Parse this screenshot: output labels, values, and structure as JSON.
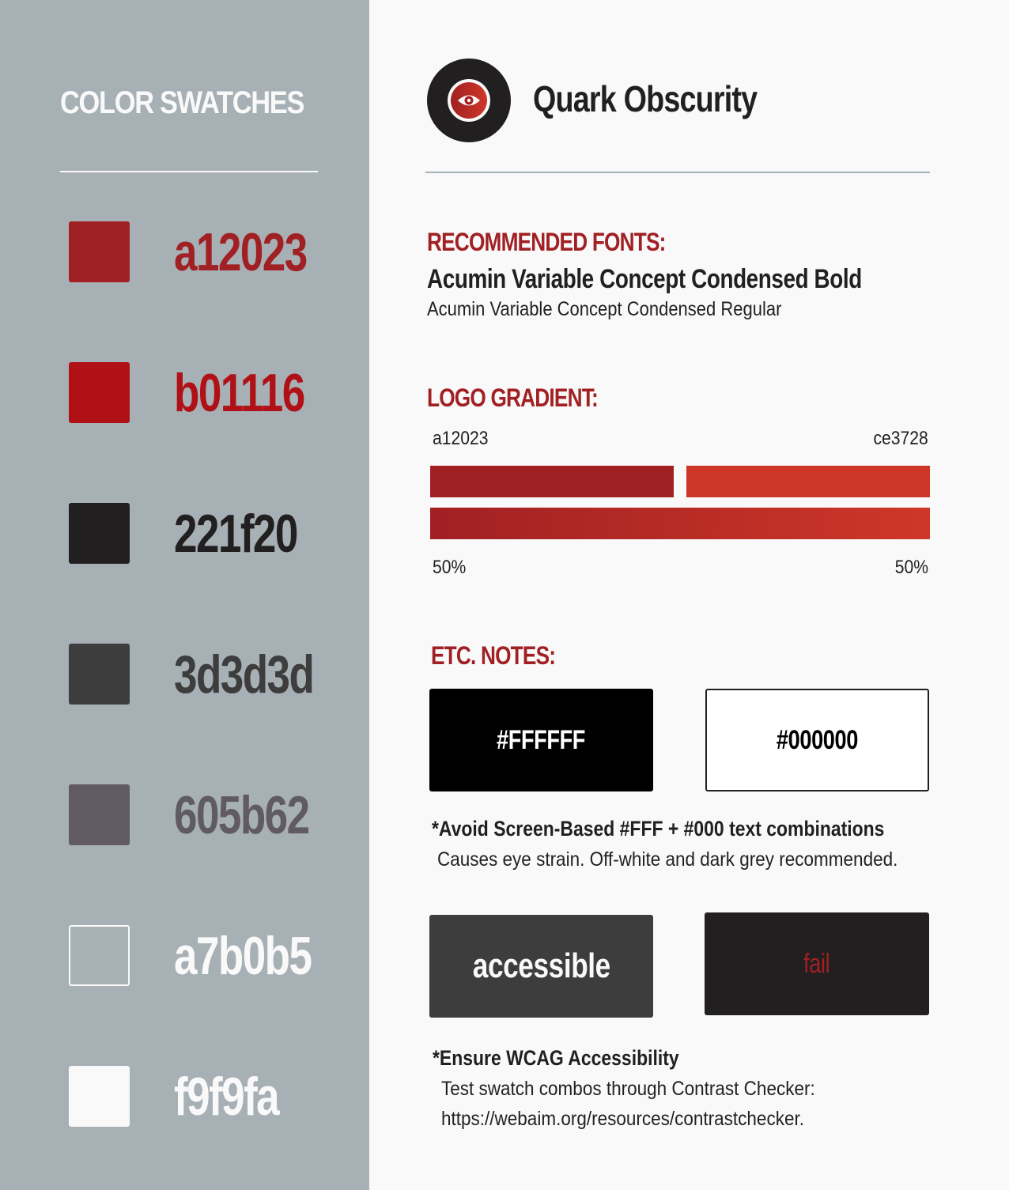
{
  "sidebar": {
    "title": "COLOR SWATCHES",
    "swatches": [
      {
        "code": "a12023",
        "color": "#a12023",
        "text_color": "#a12023"
      },
      {
        "code": "b01116",
        "color": "#b01116",
        "text_color": "#b01116"
      },
      {
        "code": "221f20",
        "color": "#221f20",
        "text_color": "#221f20"
      },
      {
        "code": "3d3d3d",
        "color": "#3d3d3d",
        "text_color": "#3d3d3d"
      },
      {
        "code": "605b62",
        "color": "#605b62",
        "text_color": "#605b62"
      },
      {
        "code": "a7b0b5",
        "color": "#a7b0b5",
        "text_color": "#f9f9fa"
      },
      {
        "code": "f9f9fa",
        "color": "#f9f9fa",
        "text_color": "#f9f9fa"
      }
    ]
  },
  "header": {
    "brand": "Quark Obscurity",
    "logo_icon": "eye-icon"
  },
  "fonts": {
    "heading": "RECOMMENDED FONTS:",
    "primary": "Acumin Variable Concept Condensed Bold",
    "secondary": "Acumin Variable Concept Condensed Regular"
  },
  "gradient": {
    "heading": "LOGO GRADIENT:",
    "start_label": "a12023",
    "end_label": "ce3728",
    "start_color": "#a12023",
    "end_color": "#ce3728",
    "start_pct": "50%",
    "end_pct": "50%"
  },
  "notes": {
    "heading": "ETC. NOTES:",
    "box_black_label": "#FFFFFF",
    "box_white_label": "#000000",
    "note1_bold": "*Avoid Screen-Based #FFF + #000 text combinations",
    "note1_text": "Causes eye strain. Off-white and dark grey recommended.",
    "box_accessible_label": "accessible",
    "box_fail_label": "fail",
    "note2_bold": "*Ensure WCAG Accessibility",
    "note2_line1": "Test swatch combos through Contrast Checker:",
    "note2_line2": "https://webaim.org/resources/contrastchecker."
  }
}
